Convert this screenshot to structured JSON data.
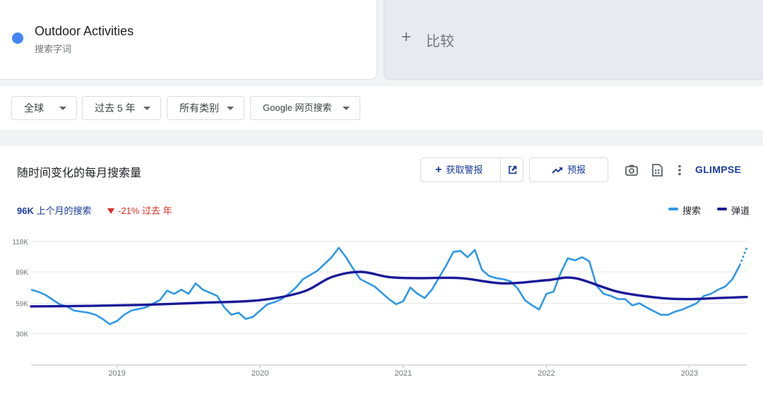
{
  "term": {
    "name": "Outdoor Activities",
    "type": "搜索字词",
    "color": "#4285f4"
  },
  "compare": {
    "plus": "+",
    "label": "比较"
  },
  "filters": [
    {
      "label": "全球"
    },
    {
      "label": "过去 5 年"
    },
    {
      "label": "所有类别"
    },
    {
      "label": "Google 网页搜索"
    }
  ],
  "panel": {
    "title": "随时间变化的每月搜索量",
    "alert_button": "获取警报",
    "forecast_button": "预报",
    "brand": "GLIMPSE",
    "last_month_value": "96K",
    "last_month_label": "上个月的搜索",
    "yoy_value": "-21%",
    "yoy_label": "过去 年"
  },
  "colors": {
    "search": "#2f98e8",
    "trend": "#1a1a99",
    "accent": "#1a3a9e",
    "negative": "#d93025"
  },
  "chart_data": {
    "type": "line",
    "y_ticks": [
      30000,
      59000,
      89000,
      118000
    ],
    "y_tick_labels": [
      "30K",
      "59K",
      "89K",
      "118K"
    ],
    "x_ticks": [
      2019,
      2020,
      2021,
      2022,
      2023
    ],
    "x_tick_labels": [
      "2019",
      "2020",
      "2021",
      "2022",
      "2023"
    ],
    "grid": true,
    "legend": "top-right",
    "series": [
      {
        "name": "搜索",
        "x": [
          2018.4,
          2018.45,
          2018.5,
          2018.6,
          2018.65,
          2018.7,
          2018.8,
          2018.85,
          2018.9,
          2018.95,
          2019.0,
          2019.05,
          2019.1,
          2019.2,
          2019.3,
          2019.35,
          2019.4,
          2019.45,
          2019.5,
          2019.55,
          2019.6,
          2019.7,
          2019.75,
          2019.8,
          2019.85,
          2019.9,
          2019.95,
          2020.0,
          2020.05,
          2020.1,
          2020.15,
          2020.2,
          2020.25,
          2020.3,
          2020.4,
          2020.5,
          2020.55,
          2020.6,
          2020.65,
          2020.7,
          2020.8,
          2020.85,
          2020.9,
          2020.95,
          2021.0,
          2021.05,
          2021.1,
          2021.15,
          2021.2,
          2021.3,
          2021.35,
          2021.4,
          2021.45,
          2021.5,
          2021.55,
          2021.6,
          2021.65,
          2021.7,
          2021.75,
          2021.8,
          2021.85,
          2021.9,
          2021.95,
          2022.0,
          2022.05,
          2022.1,
          2022.15,
          2022.2,
          2022.25,
          2022.3,
          2022.35,
          2022.4,
          2022.45,
          2022.5,
          2022.55,
          2022.6,
          2022.65,
          2022.7,
          2022.8,
          2022.85,
          2022.9,
          2022.95,
          2023.0,
          2023.05,
          2023.1,
          2023.15,
          2023.2,
          2023.25,
          2023.3,
          2023.35,
          2023.4
        ],
        "values": [
          72000,
          70000,
          67000,
          58000,
          56000,
          52000,
          50000,
          48000,
          44000,
          39000,
          42000,
          48000,
          52000,
          55000,
          62000,
          71000,
          68000,
          72000,
          68000,
          78000,
          72000,
          66000,
          55000,
          48000,
          50000,
          44000,
          46000,
          52000,
          58000,
          60000,
          63000,
          68000,
          74000,
          82000,
          90000,
          103000,
          112000,
          103000,
          92000,
          82000,
          75000,
          69000,
          63000,
          58000,
          61000,
          74000,
          68000,
          64000,
          72000,
          95000,
          108000,
          109000,
          103000,
          110000,
          91000,
          85000,
          83000,
          82000,
          80000,
          73000,
          62000,
          57000,
          53000,
          68000,
          70000,
          88000,
          102000,
          100000,
          103000,
          99000,
          76000,
          68000,
          66000,
          63000,
          63000,
          57000,
          59000,
          55000,
          48000,
          48000,
          51000,
          53000,
          56000,
          59000,
          66000,
          68000,
          72000,
          75000,
          82000,
          95000,
          112000
        ],
        "forecast_from_index": 89
      },
      {
        "name": "弹道",
        "x": [
          2018.4,
          2018.8,
          2019.2,
          2019.6,
          2020.0,
          2020.3,
          2020.5,
          2020.7,
          2020.9,
          2021.1,
          2021.4,
          2021.7,
          2022.0,
          2022.2,
          2022.5,
          2022.8,
          2023.0,
          2023.2,
          2023.4
        ],
        "values": [
          56000,
          56500,
          57500,
          59500,
          62000,
          70000,
          84000,
          89000,
          84000,
          83000,
          83000,
          78000,
          81000,
          83000,
          70000,
          64000,
          63000,
          64000,
          65000
        ]
      }
    ]
  }
}
